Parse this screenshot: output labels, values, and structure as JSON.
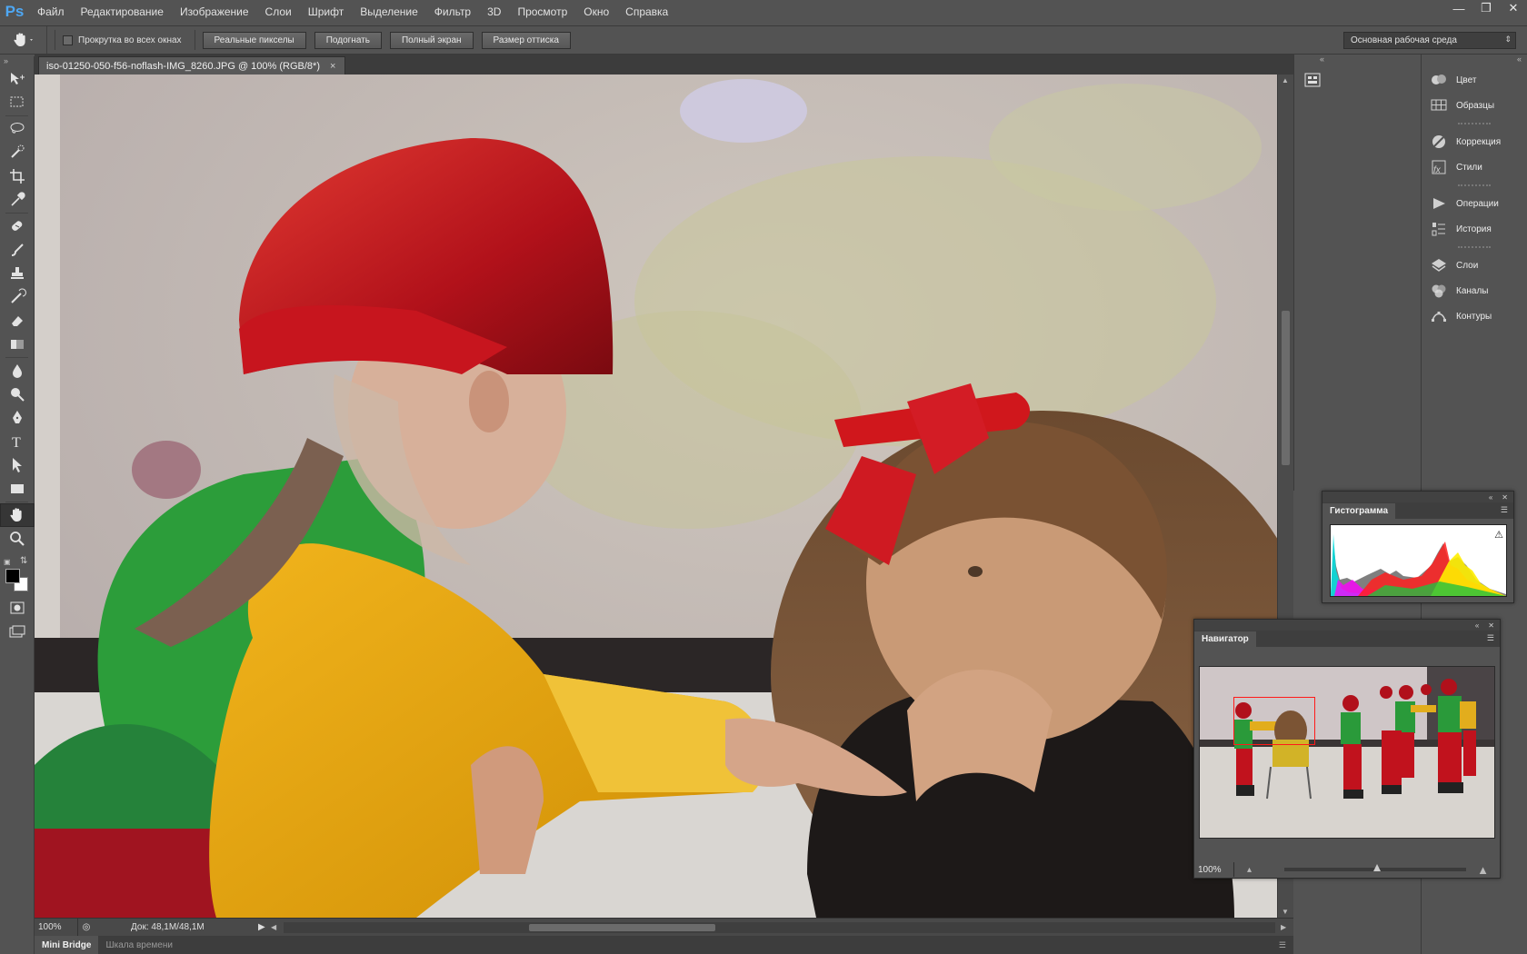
{
  "app": {
    "logo": "Ps",
    "window_controls": [
      "minimize-icon",
      "restore-icon",
      "close-icon"
    ]
  },
  "menu": [
    "Файл",
    "Редактирование",
    "Изображение",
    "Слои",
    "Шрифт",
    "Выделение",
    "Фильтр",
    "3D",
    "Просмотр",
    "Окно",
    "Справка"
  ],
  "options": {
    "scroll_all": "Прокрутка во всех окнах",
    "buttons": [
      "Реальные пикселы",
      "Подогнать",
      "Полный экран",
      "Размер оттиска"
    ],
    "workspace": "Основная рабочая среда"
  },
  "tools": [
    "move-icon",
    "rect-marquee-icon",
    "lasso-icon",
    "quick-select-icon",
    "crop-icon",
    "eyedropper-icon",
    "healing-brush-icon",
    "brush-icon",
    "clone-stamp-icon",
    "history-brush-icon",
    "eraser-icon",
    "gradient-icon",
    "blur-icon",
    "dodge-icon",
    "pen-icon",
    "type-icon",
    "path-select-icon",
    "rectangle-icon",
    "hand-icon",
    "zoom-icon"
  ],
  "document": {
    "tab_title": "iso-01250-050-f56-noflash-IMG_8260.JPG @ 100% (RGB/8*)",
    "zoom": "100%",
    "doc_info": "Док: 48,1M/48,1M"
  },
  "bottom_tabs": [
    "Mini Bridge",
    "Шкала времени"
  ],
  "dock": {
    "groups": [
      [
        {
          "icon": "color-icon",
          "label": "Цвет"
        },
        {
          "icon": "swatches-icon",
          "label": "Образцы"
        }
      ],
      [
        {
          "icon": "adjustments-icon",
          "label": "Коррекция"
        },
        {
          "icon": "styles-icon",
          "label": "Стили"
        }
      ],
      [
        {
          "icon": "actions-icon",
          "label": "Операции"
        },
        {
          "icon": "history-icon",
          "label": "История"
        }
      ],
      [
        {
          "icon": "layers-icon",
          "label": "Слои"
        },
        {
          "icon": "channels-icon",
          "label": "Каналы"
        },
        {
          "icon": "paths-icon",
          "label": "Контуры"
        }
      ]
    ]
  },
  "histogram": {
    "title": "Гистограмма"
  },
  "navigator": {
    "title": "Навигатор",
    "zoom": "100%"
  },
  "colors": {
    "foreground": "#000000",
    "background": "#ffffff",
    "nav_frame": "#ff1a1a"
  }
}
